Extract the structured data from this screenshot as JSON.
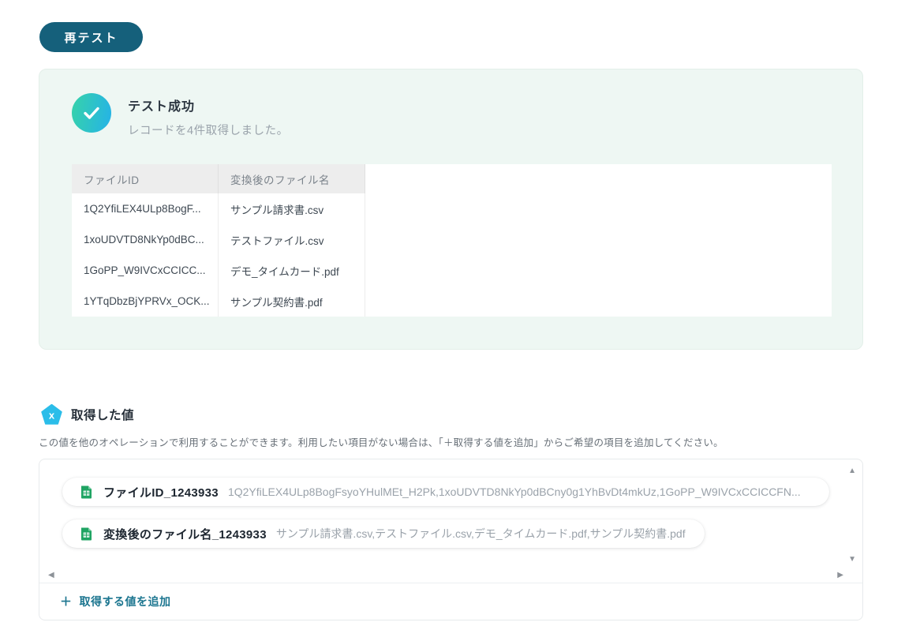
{
  "colors": {
    "button_teal": "#15607b",
    "link_teal": "#1b758f",
    "mint_panel_bg": "#eef7f3",
    "check_gradient_start": "#36d3a9",
    "check_gradient_end": "#25b2e8",
    "pentagon_cyan": "#2bbde9",
    "sheets_green": "#1ea court"
  },
  "retest_button": {
    "label": "再テスト"
  },
  "success_panel": {
    "title": "テスト成功",
    "subtitle": "レコードを4件取得しました。",
    "table": {
      "columns": [
        "ファイルID",
        "変換後のファイル名"
      ],
      "rows": [
        [
          "1Q2YfiLEX4ULp8BogF...",
          "サンプル請求書.csv"
        ],
        [
          "1xoUDVTD8NkYp0dBC...",
          "テストファイル.csv"
        ],
        [
          "1GoPP_W9IVCxCCICC...",
          "デモ_タイムカード.pdf"
        ],
        [
          "1YTqDbzBjYPRVx_OCK...",
          "サンプル契約書.pdf"
        ]
      ]
    }
  },
  "values_section": {
    "title": "取得した値",
    "description": "この値を他のオペレーションで利用することができます。利用したい項目がない場合は、「＋取得する値を追加」からご希望の項目を追加してください。",
    "items": [
      {
        "label": "ファイルID_1243933",
        "value": "1Q2YfiLEX4ULp8BogFsyoYHulMEt_H2Pk,1xoUDVTD8NkYp0dBCny0g1YhBvDt4mkUz,1GoPP_W9IVCxCCICCFN..."
      },
      {
        "label": "変換後のファイル名_1243933",
        "value": "サンプル請求書.csv,テストファイル.csv,デモ_タイムカード.pdf,サンプル契約書.pdf"
      }
    ],
    "add_value": {
      "plus": "＋",
      "label": "取得する値を追加"
    },
    "scroll_icons": {
      "up": "▲",
      "down": "▼",
      "left": "◀",
      "right": "▶"
    }
  }
}
